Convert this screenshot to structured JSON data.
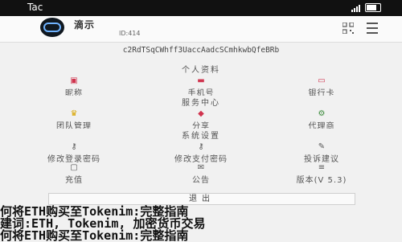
{
  "status_bar": {
    "time": "Tac"
  },
  "header": {
    "name": "滴示",
    "id": "ID:414"
  },
  "address": "c2RdTSqCWhff3UaccAadcSCmhkwbQfeBRb",
  "personal": {
    "title": "个人资料",
    "items": [
      {
        "glyph": "▣",
        "label": "昵称"
      },
      {
        "glyph": "▬",
        "label": "手机号"
      },
      {
        "glyph": "▭",
        "label": "银行卡"
      }
    ]
  },
  "service": {
    "title": "服务中心",
    "items": [
      {
        "glyph": "♛",
        "label": "团队管理"
      },
      {
        "glyph": "◆",
        "label": "分享"
      },
      {
        "glyph": "⚙",
        "label": "代理商"
      }
    ]
  },
  "system": {
    "title": "系统设置",
    "items": [
      {
        "glyph": "⚷",
        "label": "修改登录密码"
      },
      {
        "glyph": "⚷",
        "label": "修改支付密码"
      },
      {
        "glyph": "✎",
        "label": "投诉建议"
      },
      {
        "glyph": "▢",
        "label": "充值"
      },
      {
        "glyph": "✉",
        "label": "公告"
      },
      {
        "glyph": "≡",
        "label": "版本(V 5.3)"
      }
    ]
  },
  "logout": {
    "label": "退出"
  },
  "overlay_text": {
    "line1": "何将ETH购买至Tokenim:完整指南",
    "line2": "建词:ETH, Tokenim, 加密货币交易",
    "line3": "何将ETH购买至Tokenim:完整指南"
  }
}
